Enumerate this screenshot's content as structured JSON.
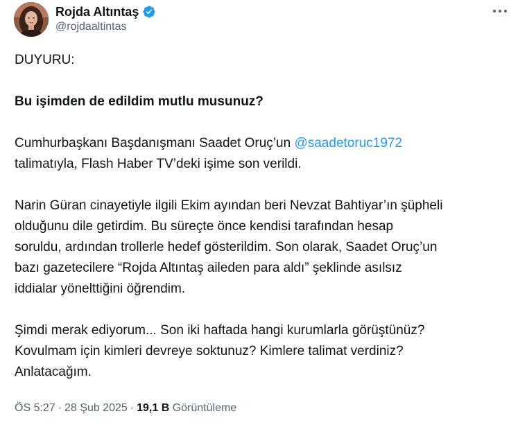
{
  "author": {
    "display_name": "Rojda Altıntaş",
    "handle": "@rojdaaltintas",
    "verified": true,
    "avatar_icon": "profile-photo"
  },
  "tweet": {
    "line_announcement": "DUYURU:",
    "line_question": "Bu işimden de edildim mutlu musunuz?",
    "p1_before_mention": "Cumhurbaşkanı Başdanışmanı Saadet Oruç’un ",
    "p1_mention": "@saadetoruc1972",
    "p1_after_mention": "talimatıyla, Flash Haber TV’deki işime son verildi.",
    "p2_line1": "Narin Güran cinayetiyle ilgili Ekim ayından beri Nevzat Bahtiyar’ın şüpheli",
    "p2_line2": "olduğunu dile getirdim. Bu süreçte önce kendisi tarafından hesap",
    "p2_line3": "soruldu, ardından trollerle hedef gösterildim. Son olarak, Saadet Oruç’un",
    "p2_line4": "bazı gazetecilere “Rojda Altıntaş aileden para aldı” şeklinde asılsız",
    "p2_line5": "iddialar yönelttiğini öğrendim.",
    "p3_line1": "Şimdi merak ediyorum... Son iki haftada hangi kurumlarla görüştünüz?",
    "p3_line2": "Kovulmam için kimleri devreye soktunuz? Kimlere talimat verdiniz?",
    "p3_line3": "Anlatacağım."
  },
  "footer": {
    "time": "ÖS 5:27",
    "separator": "·",
    "date": "28 Şub 2025",
    "views_count": "19,1 B",
    "views_label": "Görüntüleme"
  },
  "colors": {
    "link": "#1d9bf0",
    "verified_badge": "#1d9bf0",
    "secondary_text": "#536471"
  },
  "icons": {
    "more": "more-horizontal-icon",
    "verified": "verified-badge-icon"
  }
}
